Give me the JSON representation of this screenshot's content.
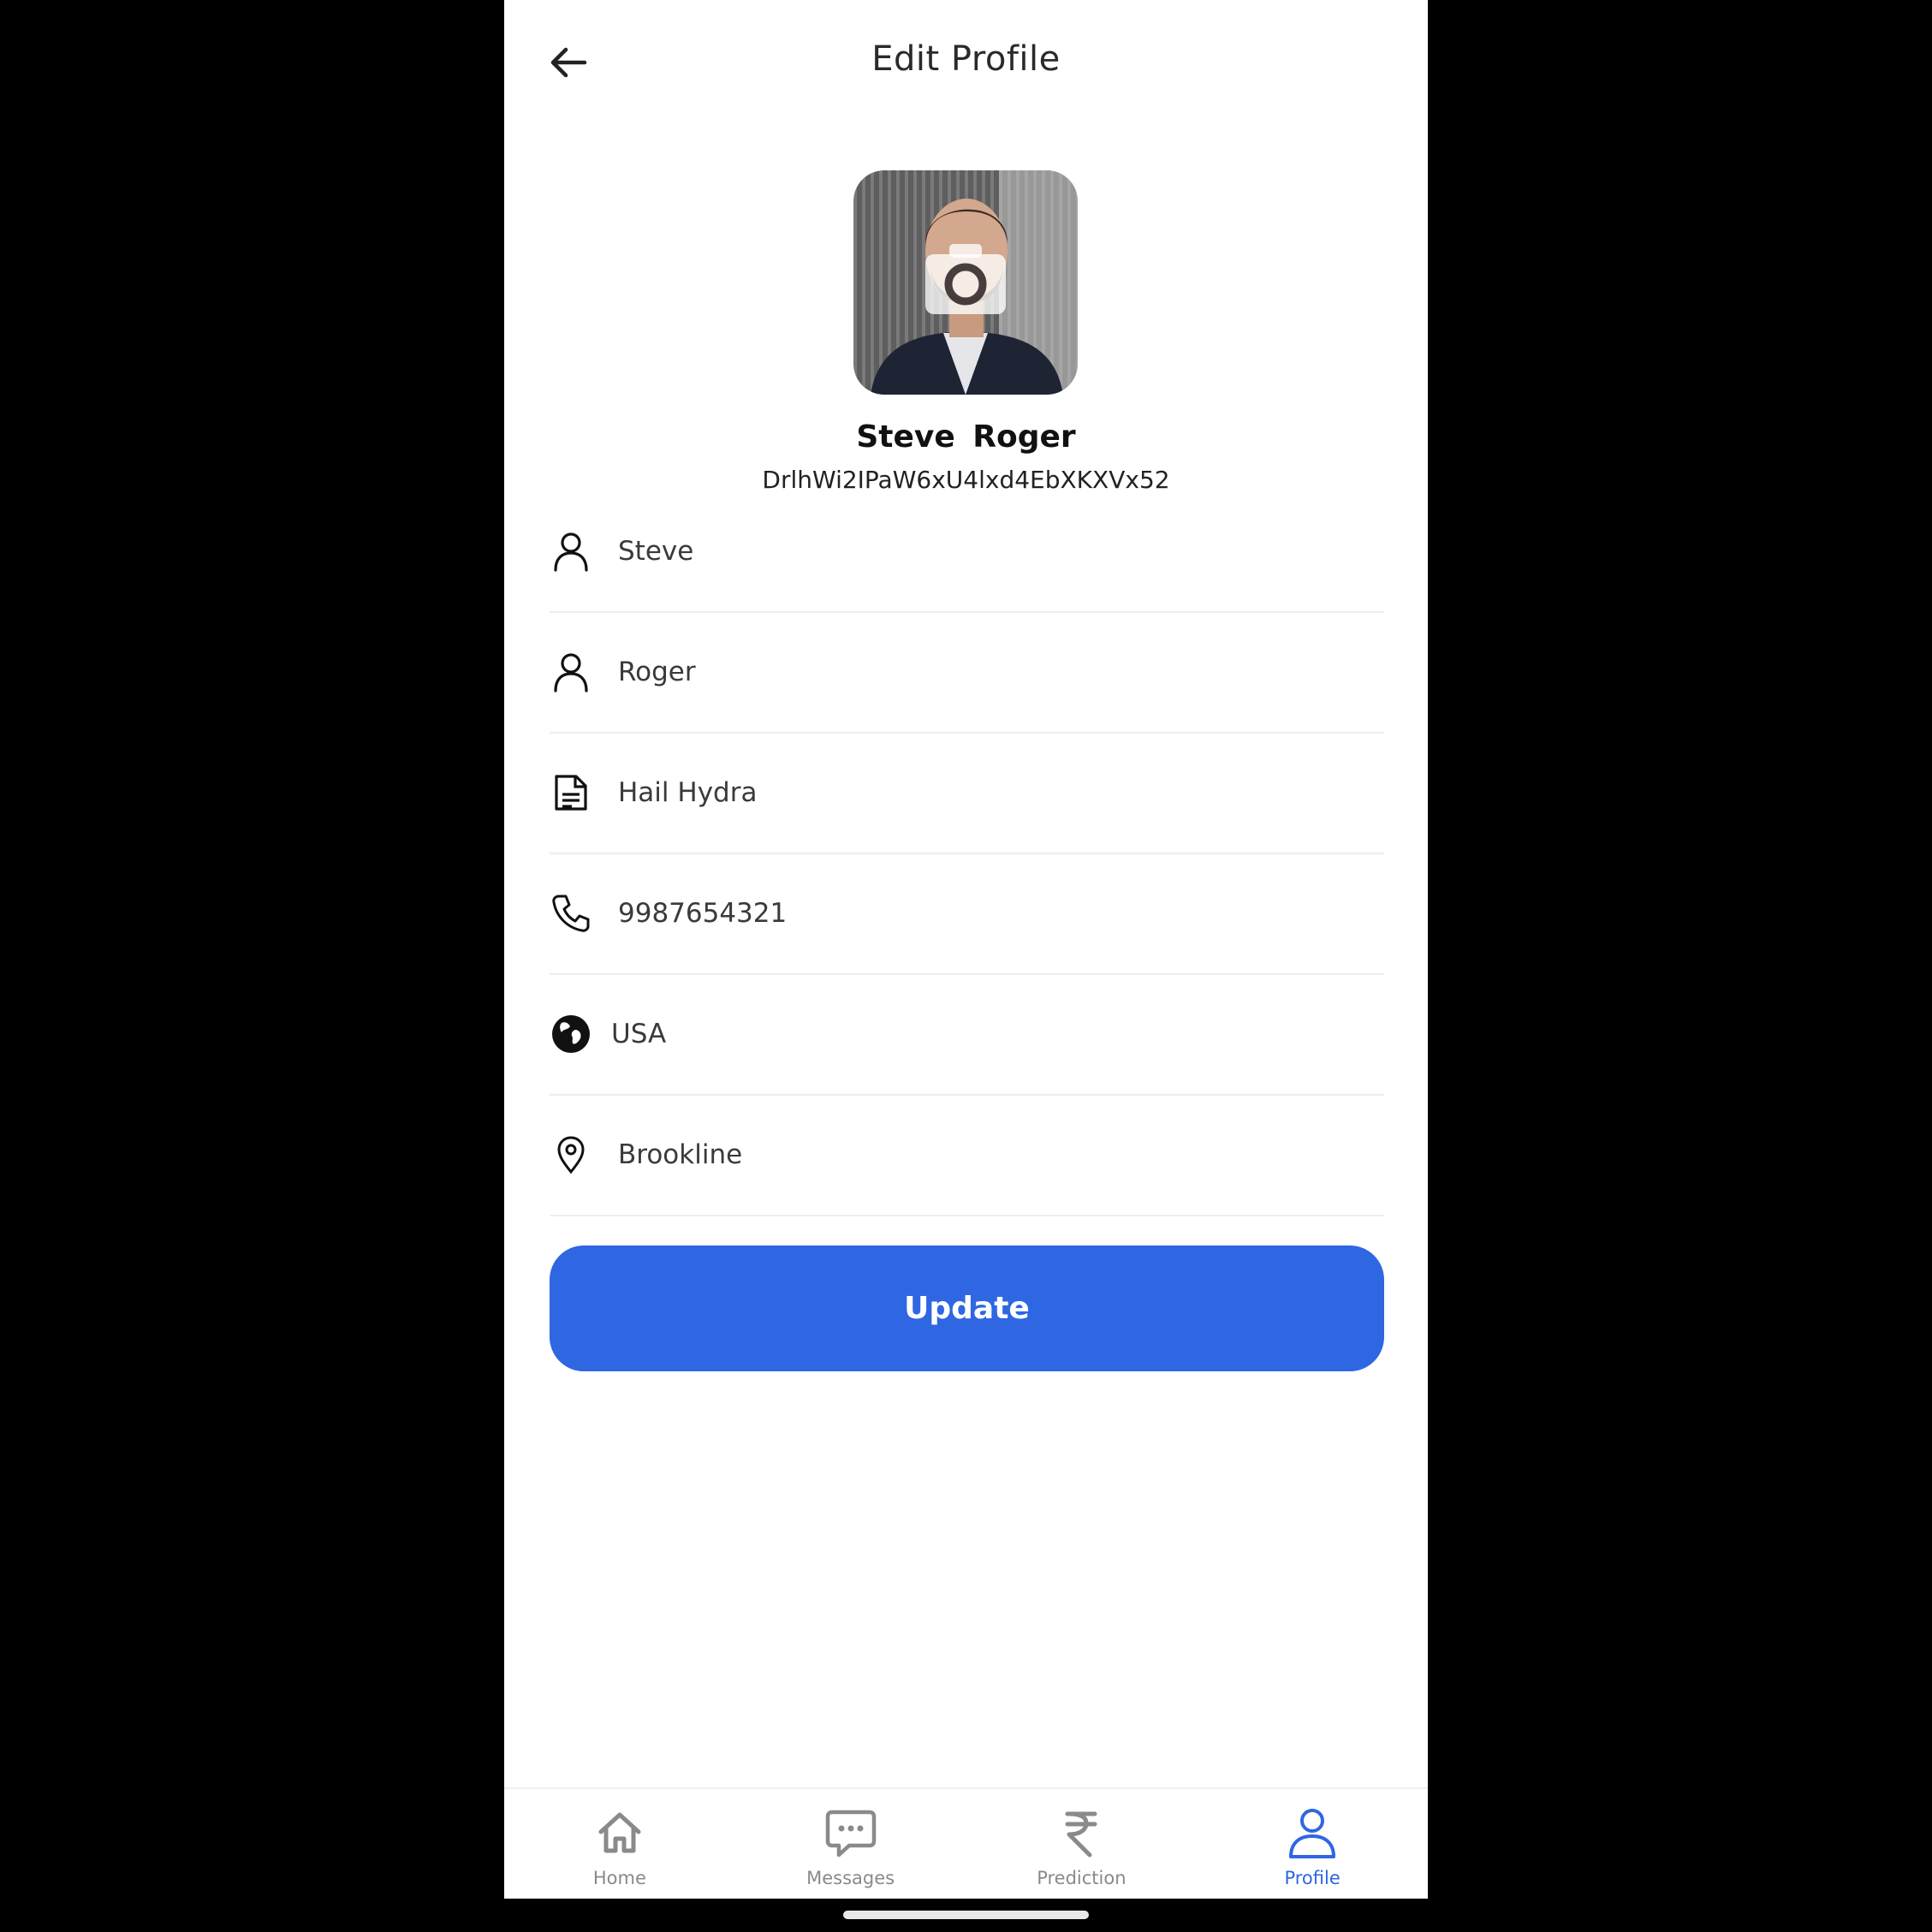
{
  "header": {
    "title": "Edit Profile"
  },
  "profile": {
    "full_name": "Steve Roger",
    "user_id": "DrlhWi2IPaW6xU4lxd4EbXKXVx52"
  },
  "form": {
    "first_name": "Steve",
    "last_name": "Roger",
    "bio": "Hail Hydra",
    "phone": "9987654321",
    "country": "USA",
    "city": "Brookline"
  },
  "actions": {
    "update_label": "Update"
  },
  "bottom_nav": {
    "items": [
      {
        "label": "Home",
        "icon": "home-icon",
        "active": false
      },
      {
        "label": "Messages",
        "icon": "chat-icon",
        "active": false
      },
      {
        "label": "Prediction",
        "icon": "rupee-icon",
        "active": false
      },
      {
        "label": "Profile",
        "icon": "person-icon",
        "active": true
      }
    ]
  },
  "colors": {
    "accent": "#2f67e2",
    "inactive": "#8a8a8a"
  }
}
